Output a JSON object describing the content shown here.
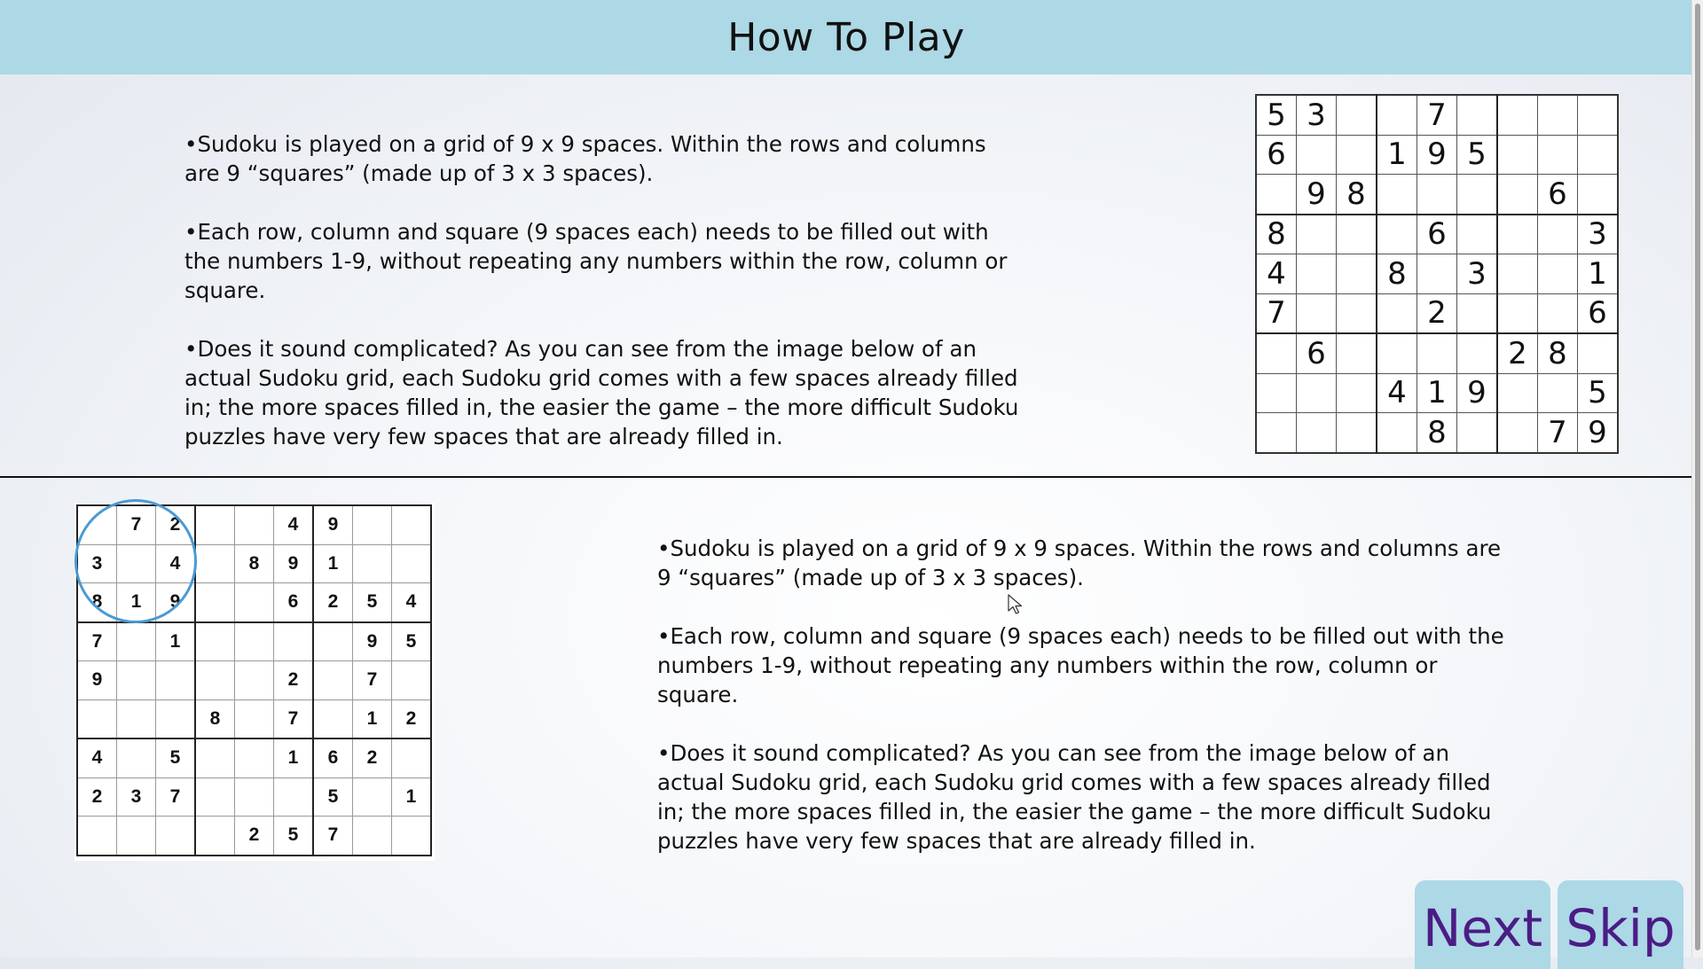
{
  "header": {
    "title": "How To Play"
  },
  "instructions": {
    "paragraphs": [
      "•Sudoku is played on a grid of 9 x 9 spaces. Within the rows and columns are 9 “squares” (made up of 3 x 3 spaces).",
      "•Each row, column and square (9 spaces each) needs to be filled out with the numbers 1-9, without repeating any numbers within the row, column or square.",
      "•Does it sound complicated? As you can see from the image below of an actual Sudoku grid, each Sudoku grid comes with a few spaces already filled in; the more spaces filled in, the easier the game – the more difficult Sudoku puzzles have very few spaces that are already filled in."
    ]
  },
  "grid_top": [
    [
      "5",
      "3",
      "",
      "",
      "7",
      "",
      "",
      "",
      ""
    ],
    [
      "6",
      "",
      "",
      "1",
      "9",
      "5",
      "",
      "",
      ""
    ],
    [
      "",
      "9",
      "8",
      "",
      "",
      "",
      "",
      "6",
      ""
    ],
    [
      "8",
      "",
      "",
      "",
      "6",
      "",
      "",
      "",
      "3"
    ],
    [
      "4",
      "",
      "",
      "8",
      "",
      "3",
      "",
      "",
      "1"
    ],
    [
      "7",
      "",
      "",
      "",
      "2",
      "",
      "",
      "",
      "6"
    ],
    [
      "",
      "6",
      "",
      "",
      "",
      "",
      "2",
      "8",
      ""
    ],
    [
      "",
      "",
      "",
      "4",
      "1",
      "9",
      "",
      "",
      "5"
    ],
    [
      "",
      "",
      "",
      "",
      "8",
      "",
      "",
      "7",
      "9"
    ]
  ],
  "grid_bottom": [
    [
      "",
      "7",
      "2",
      "",
      "",
      "4",
      "9",
      "",
      ""
    ],
    [
      "3",
      "",
      "4",
      "",
      "8",
      "9",
      "1",
      "",
      ""
    ],
    [
      "8",
      "1",
      "9",
      "",
      "",
      "6",
      "2",
      "5",
      "4"
    ],
    [
      "7",
      "",
      "1",
      "",
      "",
      "",
      "",
      "9",
      "5"
    ],
    [
      "9",
      "",
      "",
      "",
      "",
      "2",
      "",
      "7",
      ""
    ],
    [
      "",
      "",
      "",
      "8",
      "",
      "7",
      "",
      "1",
      "2"
    ],
    [
      "4",
      "",
      "5",
      "",
      "",
      "1",
      "6",
      "2",
      ""
    ],
    [
      "2",
      "3",
      "7",
      "",
      "",
      "",
      "5",
      "",
      "1"
    ],
    [
      "",
      "",
      "",
      "",
      "2",
      "5",
      "7",
      "",
      ""
    ]
  ],
  "buttons": {
    "next": "Next",
    "skip": "Skip"
  },
  "colors": {
    "header_bg": "#add8e6",
    "button_text": "#4b1c86",
    "highlight": "#4a9ad4"
  }
}
